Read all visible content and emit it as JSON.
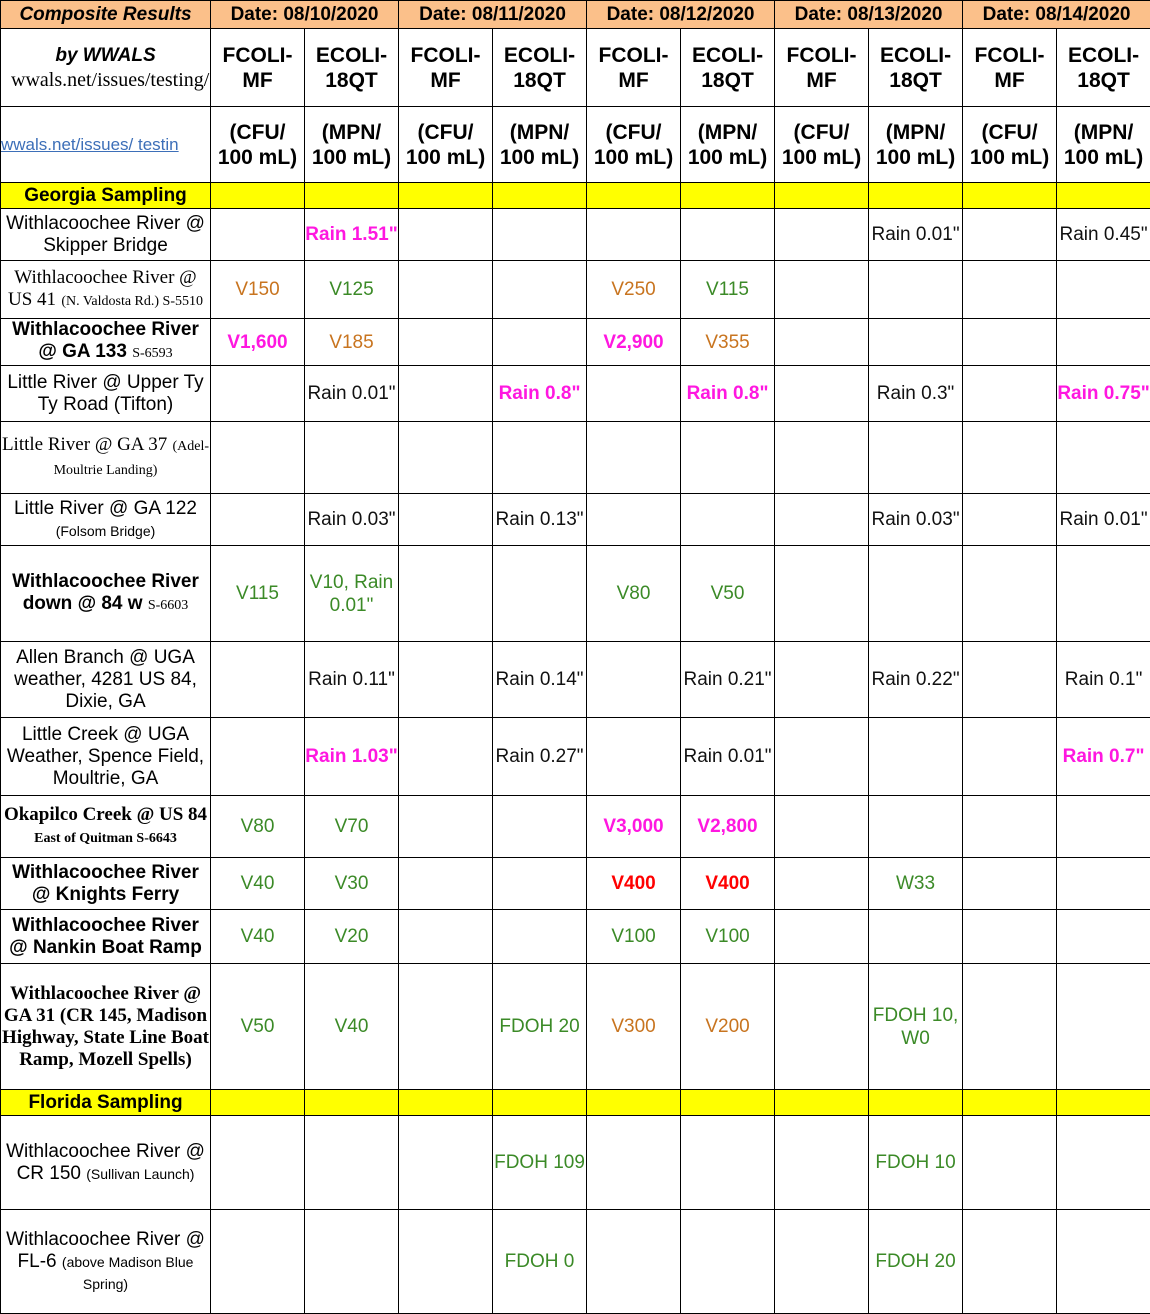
{
  "header": {
    "corner": "Composite Results",
    "dates": [
      "Date:  08/10/2020",
      "Date:  08/11/2020",
      "Date:  08/12/2020",
      "Date:  08/13/2020",
      "Date:  08/14/2020"
    ],
    "by": "by WWALS",
    "by_url": "wwals.net/issues/testing/",
    "link": "wwals.net/issues/ testin",
    "col_pair": [
      [
        "FCOLI-",
        "MF"
      ],
      [
        "ECOLI-",
        "18QT"
      ]
    ],
    "unit_pair": [
      [
        "(CFU/",
        "100 mL)"
      ],
      [
        "(MPN/",
        "100 mL)"
      ]
    ]
  },
  "sections": {
    "georgia": "Georgia Sampling",
    "florida": "Florida Sampling"
  },
  "sites": [
    {
      "main": "Withlacoochee River @ Skipper Bridge",
      "sub": "",
      "style": "plain"
    },
    {
      "main": "Withlacoochee River @ US 41",
      "sub": "(N. Valdosta Rd.) S-5510",
      "style": "serif"
    },
    {
      "main": "Withlacoochee River @ GA 133",
      "sub": "S-6593",
      "style": "bold"
    },
    {
      "main": "Little River @ Upper Ty Ty Road (Tifton)",
      "sub": "",
      "style": "plain"
    },
    {
      "main": "Little River @ GA 37",
      "sub": "(Adel-Moultrie Landing)",
      "style": "serif"
    },
    {
      "main": "Little River @ GA 122",
      "sub": "(Folsom Bridge)",
      "style": "plain"
    },
    {
      "main": "Withlacoochee River down @ 84 w",
      "sub": "S-6603",
      "style": "bold"
    },
    {
      "main": "Allen  Branch @ UGA weather, 4281 US 84, Dixie, GA",
      "sub": "",
      "style": "plain"
    },
    {
      "main": "Little Creek @ UGA Weather, Spence Field, Moultrie, GA",
      "sub": "",
      "style": "plain"
    },
    {
      "main": "Okapilco Creek @ US 84",
      "sub": "East of Quitman S-6643",
      "style": "boldserif"
    },
    {
      "main": "Withlacoochee River @ Knights Ferry",
      "sub": "",
      "style": "bold"
    },
    {
      "main": "Withlacoochee River @ Nankin Boat Ramp",
      "sub": "",
      "style": "bold"
    },
    {
      "main": "Withlacoochee River @ GA 31 (CR 145, Madison Highway, State Line Boat Ramp, Mozell Spells)",
      "sub": "",
      "style": "boldserif"
    },
    {
      "main": "Withlacoochee River @ CR 150",
      "sub": "(Sullivan Launch)",
      "style": "plain"
    },
    {
      "main": "Withlacoochee River @ FL-6",
      "sub": "(above Madison Blue Spring)",
      "style": "plain"
    }
  ],
  "rows": [
    [
      "",
      {
        "t": "Rain 1.51\"",
        "c": "m"
      },
      "",
      "",
      "",
      "",
      "",
      {
        "t": "Rain 0.01\"",
        "c": "k"
      },
      "",
      {
        "t": "Rain 0.45\"",
        "c": "k"
      }
    ],
    [
      {
        "t": "V150",
        "c": "o"
      },
      {
        "t": "V125",
        "c": "g"
      },
      "",
      "",
      {
        "t": "V250",
        "c": "o"
      },
      {
        "t": "V115",
        "c": "g"
      },
      "",
      "",
      "",
      ""
    ],
    [
      {
        "t": "V1,600",
        "c": "m"
      },
      {
        "t": "V185",
        "c": "o"
      },
      "",
      "",
      {
        "t": "V2,900",
        "c": "m"
      },
      {
        "t": "V355",
        "c": "o"
      },
      "",
      "",
      "",
      ""
    ],
    [
      "",
      {
        "t": "Rain 0.01\"",
        "c": "k"
      },
      "",
      {
        "t": "Rain 0.8\"",
        "c": "m"
      },
      "",
      {
        "t": "Rain 0.8\"",
        "c": "m"
      },
      "",
      {
        "t": "Rain 0.3\"",
        "c": "k"
      },
      "",
      {
        "t": "Rain 0.75\"",
        "c": "m"
      }
    ],
    [
      "",
      "",
      "",
      "",
      "",
      "",
      "",
      "",
      "",
      ""
    ],
    [
      "",
      {
        "t": "Rain 0.03\"",
        "c": "k"
      },
      "",
      {
        "t": "Rain 0.13\"",
        "c": "k"
      },
      "",
      "",
      "",
      {
        "t": "Rain 0.03\"",
        "c": "k"
      },
      "",
      {
        "t": "Rain 0.01\"",
        "c": "k"
      }
    ],
    [
      {
        "t": "V115",
        "c": "g"
      },
      {
        "t": "V10, Rain 0.01\"",
        "c": "g"
      },
      "",
      "",
      {
        "t": "V80",
        "c": "g"
      },
      {
        "t": "V50",
        "c": "g"
      },
      "",
      "",
      "",
      ""
    ],
    [
      "",
      {
        "t": "Rain 0.11\"",
        "c": "k"
      },
      "",
      {
        "t": "Rain 0.14\"",
        "c": "k"
      },
      "",
      {
        "t": "Rain 0.21\"",
        "c": "k"
      },
      "",
      {
        "t": "Rain 0.22\"",
        "c": "k"
      },
      "",
      {
        "t": "Rain 0.1\"",
        "c": "k"
      }
    ],
    [
      "",
      {
        "t": "Rain 1.03\"",
        "c": "m"
      },
      "",
      {
        "t": "Rain 0.27\"",
        "c": "k"
      },
      "",
      {
        "t": "Rain 0.01\"",
        "c": "k"
      },
      "",
      "",
      "",
      {
        "t": "Rain 0.7\"",
        "c": "m"
      }
    ],
    [
      {
        "t": "V80",
        "c": "g"
      },
      {
        "t": "V70",
        "c": "g"
      },
      "",
      "",
      {
        "t": "V3,000",
        "c": "m"
      },
      {
        "t": "V2,800",
        "c": "m"
      },
      "",
      "",
      "",
      ""
    ],
    [
      {
        "t": "V40",
        "c": "g"
      },
      {
        "t": "V30",
        "c": "g"
      },
      "",
      "",
      {
        "t": "V400",
        "c": "r"
      },
      {
        "t": "V400",
        "c": "r"
      },
      "",
      {
        "t": "W33",
        "c": "g"
      },
      "",
      ""
    ],
    [
      {
        "t": "V40",
        "c": "g"
      },
      {
        "t": "V20",
        "c": "g"
      },
      "",
      "",
      {
        "t": "V100",
        "c": "g"
      },
      {
        "t": "V100",
        "c": "g"
      },
      "",
      "",
      "",
      ""
    ],
    [
      {
        "t": "V50",
        "c": "g"
      },
      {
        "t": "V40",
        "c": "g"
      },
      "",
      {
        "t": "FDOH 20",
        "c": "g"
      },
      {
        "t": "V300",
        "c": "o"
      },
      {
        "t": "V200",
        "c": "o"
      },
      "",
      {
        "t": "FDOH 10, W0",
        "c": "g"
      },
      "",
      ""
    ],
    [
      "",
      "",
      "",
      {
        "t": "FDOH 109",
        "c": "g"
      },
      "",
      "",
      "",
      {
        "t": "FDOH 10",
        "c": "g"
      },
      "",
      ""
    ],
    [
      "",
      "",
      "",
      {
        "t": "FDOH 0",
        "c": "g"
      },
      "",
      "",
      "",
      {
        "t": "FDOH 20",
        "c": "g"
      },
      "",
      ""
    ]
  ]
}
